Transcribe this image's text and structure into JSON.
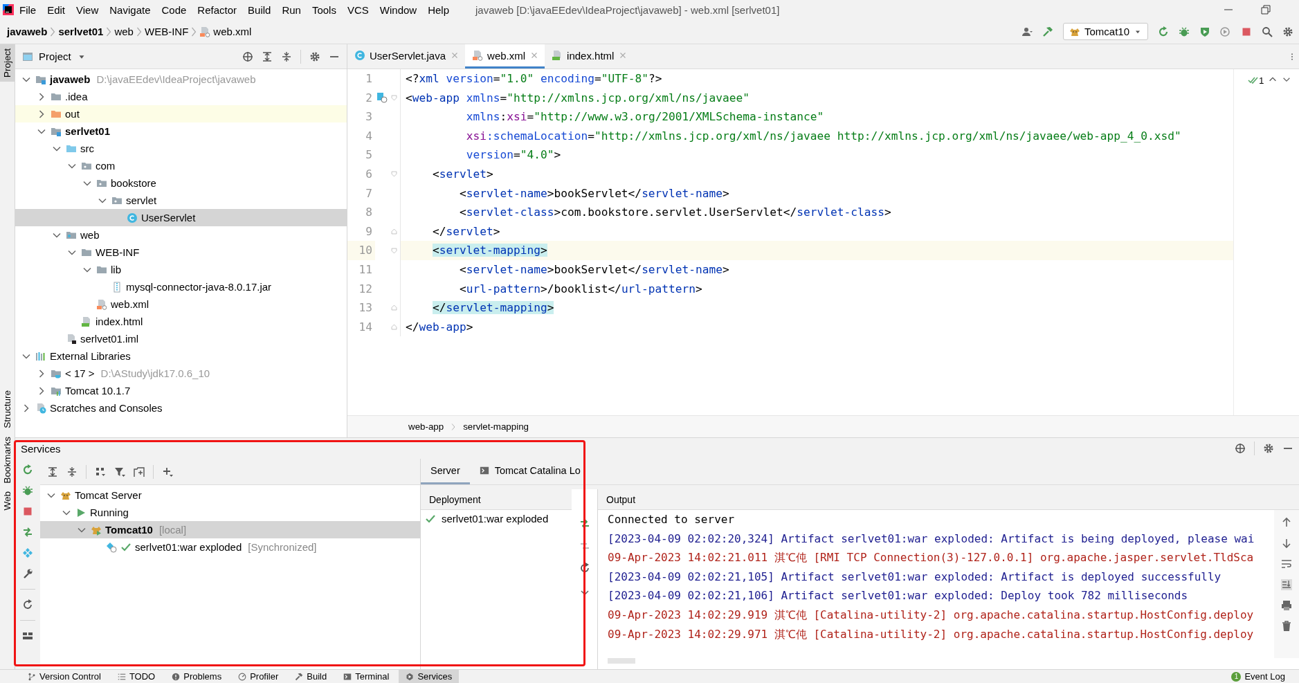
{
  "menu": [
    "File",
    "Edit",
    "View",
    "Navigate",
    "Code",
    "Refactor",
    "Build",
    "Run",
    "Tools",
    "VCS",
    "Window",
    "Help"
  ],
  "window": {
    "title": "javaweb [D:\\javaEEdev\\IdeaProject\\javaweb] - web.xml [serlvet01]"
  },
  "breadcrumb": [
    {
      "label": "javaweb",
      "bold": true
    },
    {
      "label": "serlvet01",
      "bold": true
    },
    {
      "label": "web",
      "bold": false
    },
    {
      "label": "WEB-INF",
      "bold": false
    },
    {
      "label": "web.xml",
      "bold": false,
      "kind": "xml"
    }
  ],
  "run_config": {
    "label": "Tomcat10"
  },
  "left_stripe_top": [
    {
      "label": "Project",
      "selected": true
    }
  ],
  "left_stripe_bottom": [
    {
      "label": "Structure",
      "selected": false
    },
    {
      "label": "Bookmarks",
      "selected": false
    },
    {
      "label": "Web",
      "selected": false
    }
  ],
  "project_panel": {
    "title": "Project",
    "tree": [
      {
        "label": "javaweb",
        "kind": "module",
        "bold": true,
        "path": "D:\\javaEEdev\\IdeaProject\\javaweb",
        "expanded": true,
        "selected": false,
        "children": [
          {
            "label": ".idea",
            "kind": "folder",
            "bold": false,
            "expanded": false,
            "selected": false
          },
          {
            "label": "out",
            "kind": "excluded",
            "bold": false,
            "expanded": false,
            "selected": false
          },
          {
            "label": "serlvet01",
            "kind": "module",
            "bold": true,
            "expanded": true,
            "selected": false,
            "children": [
              {
                "label": "src",
                "kind": "source",
                "bold": false,
                "expanded": true,
                "selected": false,
                "children": [
                  {
                    "label": "com",
                    "kind": "package",
                    "bold": false,
                    "expanded": true,
                    "selected": false,
                    "children": [
                      {
                        "label": "bookstore",
                        "kind": "package",
                        "bold": false,
                        "expanded": true,
                        "selected": false,
                        "children": [
                          {
                            "label": "servlet",
                            "kind": "package",
                            "bold": false,
                            "expanded": true,
                            "selected": false,
                            "children": [
                              {
                                "label": "UserServlet",
                                "kind": "class",
                                "bold": false,
                                "selected": true
                              }
                            ]
                          }
                        ]
                      }
                    ]
                  }
                ]
              },
              {
                "label": "web",
                "kind": "web",
                "bold": false,
                "expanded": true,
                "selected": false,
                "children": [
                  {
                    "label": "WEB-INF",
                    "kind": "folder",
                    "bold": false,
                    "expanded": true,
                    "selected": false,
                    "children": [
                      {
                        "label": "lib",
                        "kind": "folder",
                        "bold": false,
                        "expanded": true,
                        "selected": false,
                        "children": [
                          {
                            "label": "mysql-connector-java-8.0.17.jar",
                            "kind": "jar",
                            "bold": false,
                            "selected": false
                          }
                        ]
                      },
                      {
                        "label": "web.xml",
                        "kind": "xml",
                        "bold": false,
                        "selected": false
                      }
                    ]
                  },
                  {
                    "label": "index.html",
                    "kind": "html",
                    "bold": false,
                    "selected": false
                  }
                ]
              },
              {
                "label": "serlvet01.iml",
                "kind": "iml",
                "bold": false,
                "selected": false
              }
            ]
          }
        ]
      },
      {
        "label": "External Libraries",
        "kind": "libraries",
        "bold": false,
        "expanded": true,
        "selected": false,
        "children": [
          {
            "label": "< 17 >",
            "kind": "jdk",
            "bold": false,
            "path": "D:\\AStudy\\jdk17.0.6_10",
            "expanded": false,
            "selected": false
          },
          {
            "label": "Tomcat 10.1.7",
            "kind": "library",
            "bold": false,
            "expanded": false,
            "selected": false
          }
        ]
      },
      {
        "label": "Scratches and Consoles",
        "kind": "scratches",
        "bold": false,
        "expanded": false,
        "selected": false
      }
    ]
  },
  "editor": {
    "tabs": [
      {
        "label": "UserServlet.java",
        "kind": "class",
        "selected": false
      },
      {
        "label": "web.xml",
        "kind": "xml",
        "selected": true
      },
      {
        "label": "index.html",
        "kind": "html",
        "selected": false
      }
    ],
    "inspection_count": "1",
    "lines": [
      {
        "n": "1",
        "kind": "plain",
        "current": false,
        "matched": false,
        "code": [
          {
            "kind": "punct",
            "text": "<?"
          },
          {
            "kind": "tag",
            "text": "xml"
          },
          {
            "kind": "attr",
            "text": " version"
          },
          {
            "kind": "punct",
            "text": "="
          },
          {
            "kind": "value",
            "text": "\"1.0\""
          },
          {
            "kind": "attr",
            "text": " encoding"
          },
          {
            "kind": "punct",
            "text": "="
          },
          {
            "kind": "value",
            "text": "\"UTF-8\""
          },
          {
            "kind": "punct",
            "text": "?>"
          }
        ]
      },
      {
        "n": "2",
        "kind": "descriptor-fold-start",
        "current": false,
        "matched": false,
        "code": [
          {
            "kind": "punct",
            "text": "<"
          },
          {
            "kind": "tag",
            "text": "web-app"
          },
          {
            "kind": "attr",
            "text": " xmlns"
          },
          {
            "kind": "punct",
            "text": "="
          },
          {
            "kind": "value",
            "text": "\"http://xmlns.jcp.org/xml/ns/javaee\""
          }
        ]
      },
      {
        "n": "3",
        "kind": "plain",
        "current": false,
        "matched": false,
        "code": [
          {
            "kind": "attr",
            "text": "         xmlns"
          },
          {
            "kind": "punct",
            "text": ":"
          },
          {
            "kind": "ns",
            "text": "xsi"
          },
          {
            "kind": "punct",
            "text": "="
          },
          {
            "kind": "value",
            "text": "\"http://www.w3.org/2001/XMLSchema-instance\""
          }
        ]
      },
      {
        "n": "4",
        "kind": "plain",
        "current": false,
        "matched": false,
        "code": [
          {
            "kind": "ns",
            "text": "         xsi"
          },
          {
            "kind": "attr",
            "text": ":schemaLocation"
          },
          {
            "kind": "punct",
            "text": "="
          },
          {
            "kind": "value",
            "text": "\"http://xmlns.jcp.org/xml/ns/javaee http://xmlns.jcp.org/xml/ns/javaee/web-app_4_0.xsd\""
          }
        ]
      },
      {
        "n": "5",
        "kind": "plain",
        "current": false,
        "matched": false,
        "code": [
          {
            "kind": "attr",
            "text": "         version"
          },
          {
            "kind": "punct",
            "text": "="
          },
          {
            "kind": "value",
            "text": "\"4.0\""
          },
          {
            "kind": "punct",
            "text": ">"
          }
        ]
      },
      {
        "n": "6",
        "kind": "fold-start",
        "current": false,
        "matched": false,
        "code": [
          {
            "kind": "punct",
            "text": "    <"
          },
          {
            "kind": "tag",
            "text": "servlet"
          },
          {
            "kind": "punct",
            "text": ">"
          }
        ]
      },
      {
        "n": "7",
        "kind": "plain",
        "current": false,
        "matched": false,
        "code": [
          {
            "kind": "punct",
            "text": "        <"
          },
          {
            "kind": "tag",
            "text": "servlet-name"
          },
          {
            "kind": "punct",
            "text": ">bookServlet</"
          },
          {
            "kind": "tag",
            "text": "servlet-name"
          },
          {
            "kind": "punct",
            "text": ">"
          }
        ]
      },
      {
        "n": "8",
        "kind": "plain",
        "current": false,
        "matched": false,
        "code": [
          {
            "kind": "punct",
            "text": "        <"
          },
          {
            "kind": "tag",
            "text": "servlet-class"
          },
          {
            "kind": "punct",
            "text": ">com.bookstore.servlet.UserServlet</"
          },
          {
            "kind": "tag",
            "text": "servlet-class"
          },
          {
            "kind": "punct",
            "text": ">"
          }
        ]
      },
      {
        "n": "9",
        "kind": "fold-end",
        "current": false,
        "matched": false,
        "code": [
          {
            "kind": "punct",
            "text": "    </"
          },
          {
            "kind": "tag",
            "text": "servlet"
          },
          {
            "kind": "punct",
            "text": ">"
          }
        ]
      },
      {
        "n": "10",
        "kind": "fold-start",
        "current": true,
        "matched": true,
        "code": [
          {
            "kind": "punct",
            "text": "    <"
          },
          {
            "kind": "tag",
            "text": "servlet-mapping"
          },
          {
            "kind": "punct",
            "text": ">"
          }
        ]
      },
      {
        "n": "11",
        "kind": "plain",
        "current": false,
        "matched": false,
        "code": [
          {
            "kind": "punct",
            "text": "        <"
          },
          {
            "kind": "tag",
            "text": "servlet-name"
          },
          {
            "kind": "punct",
            "text": ">bookServlet</"
          },
          {
            "kind": "tag",
            "text": "servlet-name"
          },
          {
            "kind": "punct",
            "text": ">"
          }
        ]
      },
      {
        "n": "12",
        "kind": "plain",
        "current": false,
        "matched": false,
        "code": [
          {
            "kind": "punct",
            "text": "        <"
          },
          {
            "kind": "tag",
            "text": "url-pattern"
          },
          {
            "kind": "punct",
            "text": ">/booklist</"
          },
          {
            "kind": "tag",
            "text": "url-pattern"
          },
          {
            "kind": "punct",
            "text": ">"
          }
        ]
      },
      {
        "n": "13",
        "kind": "fold-end",
        "current": false,
        "matched": true,
        "code": [
          {
            "kind": "punct",
            "text": "    </"
          },
          {
            "kind": "tag",
            "text": "servlet-mapping"
          },
          {
            "kind": "punct",
            "text": ">"
          }
        ]
      },
      {
        "n": "14",
        "kind": "fold-end",
        "current": false,
        "matched": false,
        "code": [
          {
            "kind": "punct",
            "text": "</"
          },
          {
            "kind": "tag",
            "text": "web-app"
          },
          {
            "kind": "punct",
            "text": ">"
          }
        ]
      }
    ],
    "footer_breadcrumb": [
      "web-app",
      "servlet-mapping"
    ]
  },
  "services": {
    "title": "Services",
    "tree": [
      {
        "label": "Tomcat Server",
        "kind": "tomcat",
        "bold": false,
        "expanded": true,
        "selected": false,
        "children": [
          {
            "label": "Running",
            "kind": "running",
            "bold": false,
            "expanded": true,
            "selected": false,
            "children": [
              {
                "label": "Tomcat10",
                "kind": "tomcat-run",
                "bold": true,
                "suffix": "[local]",
                "expanded": true,
                "selected": true,
                "children": [
                  {
                    "label": "serlvet01:war exploded",
                    "kind": "artifact",
                    "bold": false,
                    "suffix": "[Synchronized]",
                    "selected": false
                  }
                ]
              }
            ]
          }
        ]
      }
    ],
    "tabs": [
      {
        "label": "Server",
        "selected": true
      },
      {
        "label": "Tomcat Catalina Lo",
        "selected": false
      }
    ],
    "deployment": {
      "header": "Deployment",
      "items": [
        "serlvet01:war exploded"
      ]
    },
    "output": {
      "header": "Output",
      "lines": [
        {
          "kind": "plain",
          "text": "Connected to server"
        },
        {
          "kind": "info",
          "text": "[2023-04-09 02:02:20,324] Artifact serlvet01:war exploded: Artifact is being deployed, please wai"
        },
        {
          "kind": "log",
          "text": "09-Apr-2023 14:02:21.011 淇℃伅 [RMI TCP Connection(3)-127.0.0.1] org.apache.jasper.servlet.TldSca"
        },
        {
          "kind": "info",
          "text": "[2023-04-09 02:02:21,105] Artifact serlvet01:war exploded: Artifact is deployed successfully"
        },
        {
          "kind": "info",
          "text": "[2023-04-09 02:02:21,106] Artifact serlvet01:war exploded: Deploy took 782 milliseconds"
        },
        {
          "kind": "log",
          "text": "09-Apr-2023 14:02:29.919 淇℃伅 [Catalina-utility-2] org.apache.catalina.startup.HostConfig.deploy"
        },
        {
          "kind": "log",
          "text": "09-Apr-2023 14:02:29.971 淇℃伅 [Catalina-utility-2] org.apache.catalina.startup.HostConfig.deploy"
        }
      ]
    }
  },
  "bottom_bar": {
    "tools": [
      {
        "label": "Version Control",
        "kind": "vcs",
        "selected": false
      },
      {
        "label": "TODO",
        "kind": "todo",
        "selected": false
      },
      {
        "label": "Problems",
        "kind": "problems",
        "selected": false
      },
      {
        "label": "Profiler",
        "kind": "profiler",
        "selected": false
      },
      {
        "label": "Build",
        "kind": "build",
        "selected": false
      },
      {
        "label": "Terminal",
        "kind": "terminal",
        "selected": false
      },
      {
        "label": "Services",
        "kind": "services",
        "selected": true
      }
    ],
    "event_log": {
      "label": "Event Log",
      "badge": "1"
    }
  }
}
